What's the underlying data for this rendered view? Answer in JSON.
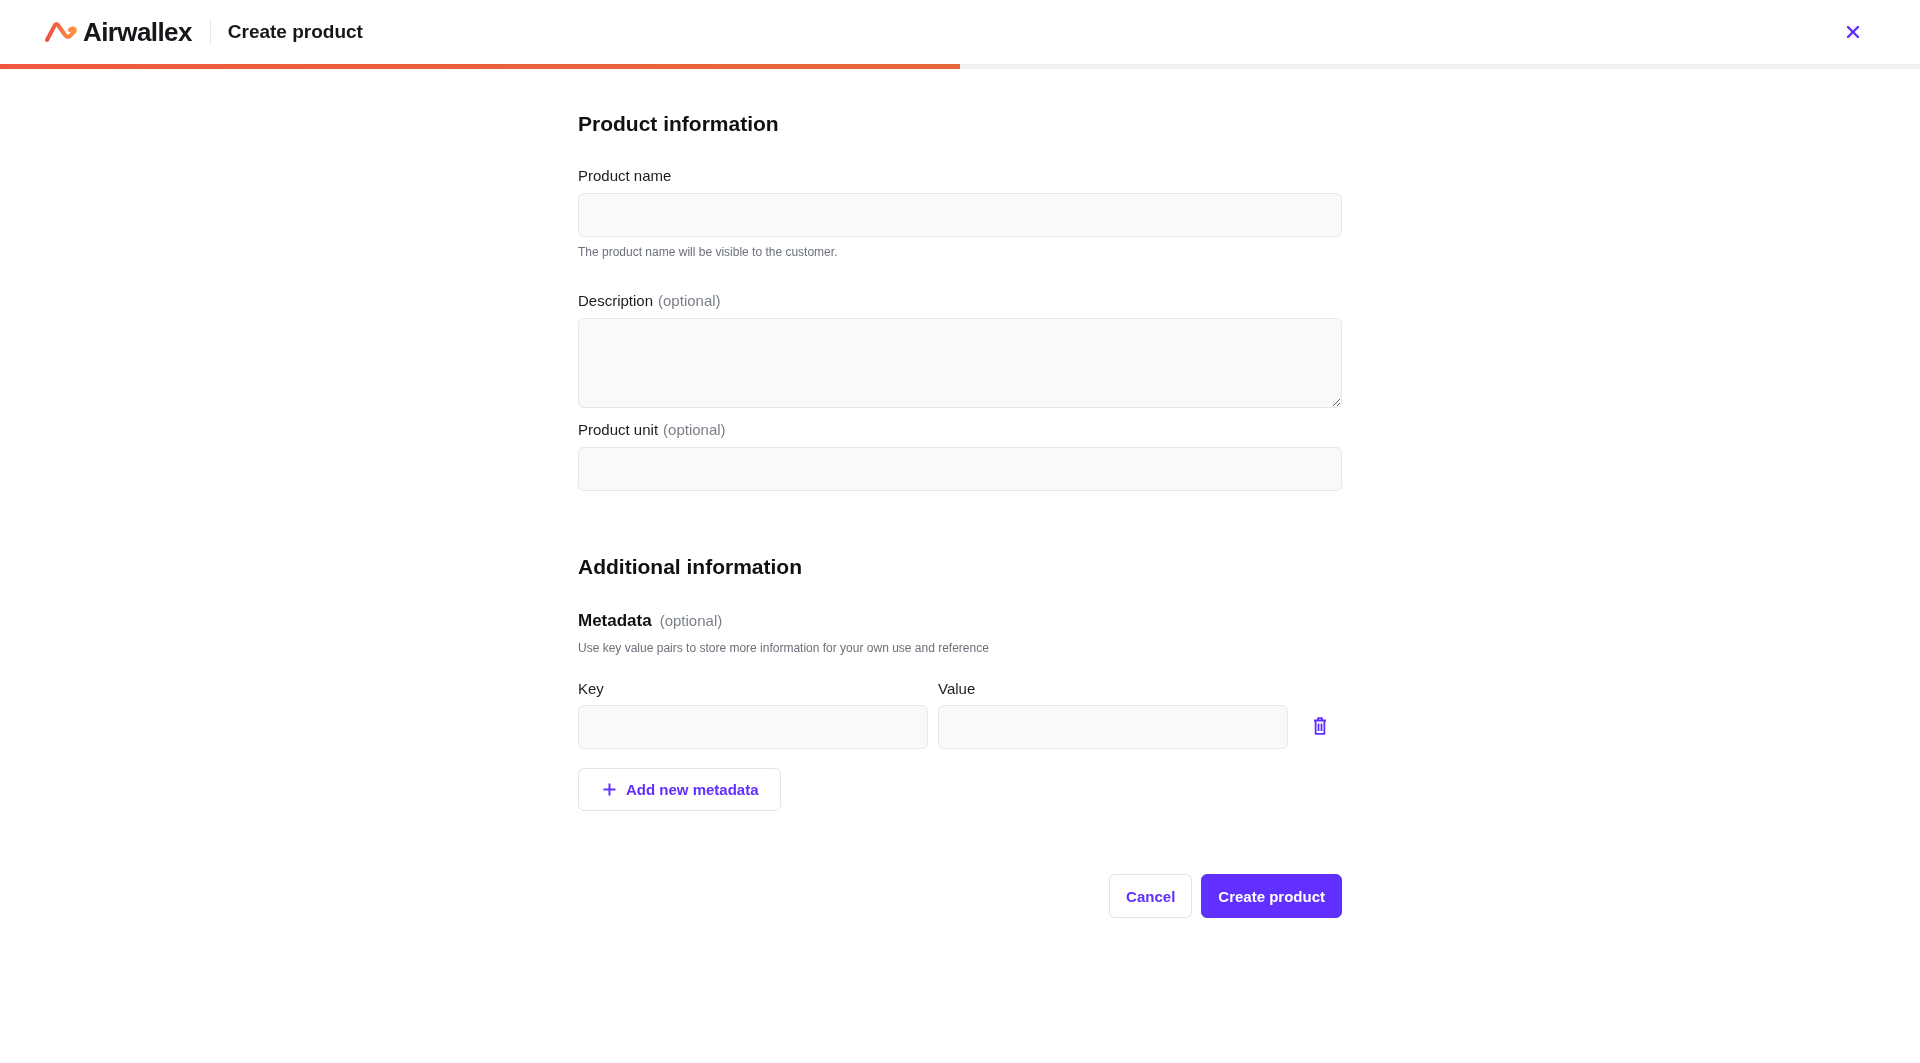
{
  "header": {
    "logo_text": "Airwallex",
    "title": "Create product"
  },
  "progress": {
    "level": 0.5
  },
  "product_information": {
    "title": "Product information",
    "fields": [
      {
        "kind": "input",
        "label": "Product name",
        "help_text": "The product name will be visible to the customer."
      },
      {
        "kind": "textarea",
        "label": "Description",
        "optional": "(optional)"
      },
      {
        "kind": "input",
        "label": "Product unit",
        "optional": "(optional)"
      }
    ]
  },
  "additional_information": {
    "title": "Additional information",
    "metadata": {
      "title": "Metadata",
      "optional": "(optional)",
      "help_text": "Use key value pairs to store more information for your own use and reference",
      "pairs": [
        {
          "key_label": "Key",
          "value_label": "Value"
        }
      ],
      "add_button": "Add new metadata"
    }
  },
  "actions": [
    {
      "kind": "secondary",
      "label": "Cancel"
    },
    {
      "kind": "primary",
      "label": "Create product"
    }
  ]
}
